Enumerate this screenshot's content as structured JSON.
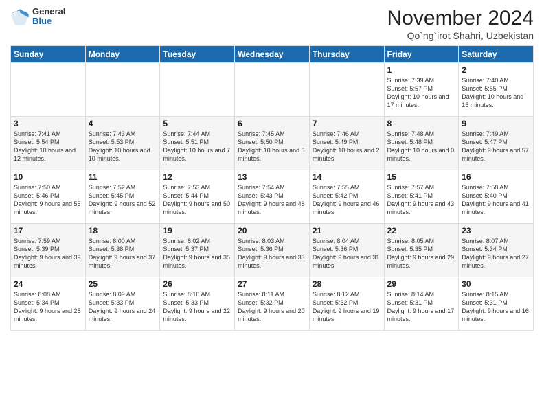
{
  "logo": {
    "general": "General",
    "blue": "Blue"
  },
  "header": {
    "month": "November 2024",
    "location": "Qo`ng`irot Shahri, Uzbekistan"
  },
  "weekdays": [
    "Sunday",
    "Monday",
    "Tuesday",
    "Wednesday",
    "Thursday",
    "Friday",
    "Saturday"
  ],
  "weeks": [
    [
      {
        "day": "",
        "info": ""
      },
      {
        "day": "",
        "info": ""
      },
      {
        "day": "",
        "info": ""
      },
      {
        "day": "",
        "info": ""
      },
      {
        "day": "",
        "info": ""
      },
      {
        "day": "1",
        "info": "Sunrise: 7:39 AM\nSunset: 5:57 PM\nDaylight: 10 hours and 17 minutes."
      },
      {
        "day": "2",
        "info": "Sunrise: 7:40 AM\nSunset: 5:55 PM\nDaylight: 10 hours and 15 minutes."
      }
    ],
    [
      {
        "day": "3",
        "info": "Sunrise: 7:41 AM\nSunset: 5:54 PM\nDaylight: 10 hours and 12 minutes."
      },
      {
        "day": "4",
        "info": "Sunrise: 7:43 AM\nSunset: 5:53 PM\nDaylight: 10 hours and 10 minutes."
      },
      {
        "day": "5",
        "info": "Sunrise: 7:44 AM\nSunset: 5:51 PM\nDaylight: 10 hours and 7 minutes."
      },
      {
        "day": "6",
        "info": "Sunrise: 7:45 AM\nSunset: 5:50 PM\nDaylight: 10 hours and 5 minutes."
      },
      {
        "day": "7",
        "info": "Sunrise: 7:46 AM\nSunset: 5:49 PM\nDaylight: 10 hours and 2 minutes."
      },
      {
        "day": "8",
        "info": "Sunrise: 7:48 AM\nSunset: 5:48 PM\nDaylight: 10 hours and 0 minutes."
      },
      {
        "day": "9",
        "info": "Sunrise: 7:49 AM\nSunset: 5:47 PM\nDaylight: 9 hours and 57 minutes."
      }
    ],
    [
      {
        "day": "10",
        "info": "Sunrise: 7:50 AM\nSunset: 5:46 PM\nDaylight: 9 hours and 55 minutes."
      },
      {
        "day": "11",
        "info": "Sunrise: 7:52 AM\nSunset: 5:45 PM\nDaylight: 9 hours and 52 minutes."
      },
      {
        "day": "12",
        "info": "Sunrise: 7:53 AM\nSunset: 5:44 PM\nDaylight: 9 hours and 50 minutes."
      },
      {
        "day": "13",
        "info": "Sunrise: 7:54 AM\nSunset: 5:43 PM\nDaylight: 9 hours and 48 minutes."
      },
      {
        "day": "14",
        "info": "Sunrise: 7:55 AM\nSunset: 5:42 PM\nDaylight: 9 hours and 46 minutes."
      },
      {
        "day": "15",
        "info": "Sunrise: 7:57 AM\nSunset: 5:41 PM\nDaylight: 9 hours and 43 minutes."
      },
      {
        "day": "16",
        "info": "Sunrise: 7:58 AM\nSunset: 5:40 PM\nDaylight: 9 hours and 41 minutes."
      }
    ],
    [
      {
        "day": "17",
        "info": "Sunrise: 7:59 AM\nSunset: 5:39 PM\nDaylight: 9 hours and 39 minutes."
      },
      {
        "day": "18",
        "info": "Sunrise: 8:00 AM\nSunset: 5:38 PM\nDaylight: 9 hours and 37 minutes."
      },
      {
        "day": "19",
        "info": "Sunrise: 8:02 AM\nSunset: 5:37 PM\nDaylight: 9 hours and 35 minutes."
      },
      {
        "day": "20",
        "info": "Sunrise: 8:03 AM\nSunset: 5:36 PM\nDaylight: 9 hours and 33 minutes."
      },
      {
        "day": "21",
        "info": "Sunrise: 8:04 AM\nSunset: 5:36 PM\nDaylight: 9 hours and 31 minutes."
      },
      {
        "day": "22",
        "info": "Sunrise: 8:05 AM\nSunset: 5:35 PM\nDaylight: 9 hours and 29 minutes."
      },
      {
        "day": "23",
        "info": "Sunrise: 8:07 AM\nSunset: 5:34 PM\nDaylight: 9 hours and 27 minutes."
      }
    ],
    [
      {
        "day": "24",
        "info": "Sunrise: 8:08 AM\nSunset: 5:34 PM\nDaylight: 9 hours and 25 minutes."
      },
      {
        "day": "25",
        "info": "Sunrise: 8:09 AM\nSunset: 5:33 PM\nDaylight: 9 hours and 24 minutes."
      },
      {
        "day": "26",
        "info": "Sunrise: 8:10 AM\nSunset: 5:33 PM\nDaylight: 9 hours and 22 minutes."
      },
      {
        "day": "27",
        "info": "Sunrise: 8:11 AM\nSunset: 5:32 PM\nDaylight: 9 hours and 20 minutes."
      },
      {
        "day": "28",
        "info": "Sunrise: 8:12 AM\nSunset: 5:32 PM\nDaylight: 9 hours and 19 minutes."
      },
      {
        "day": "29",
        "info": "Sunrise: 8:14 AM\nSunset: 5:31 PM\nDaylight: 9 hours and 17 minutes."
      },
      {
        "day": "30",
        "info": "Sunrise: 8:15 AM\nSunset: 5:31 PM\nDaylight: 9 hours and 16 minutes."
      }
    ]
  ]
}
